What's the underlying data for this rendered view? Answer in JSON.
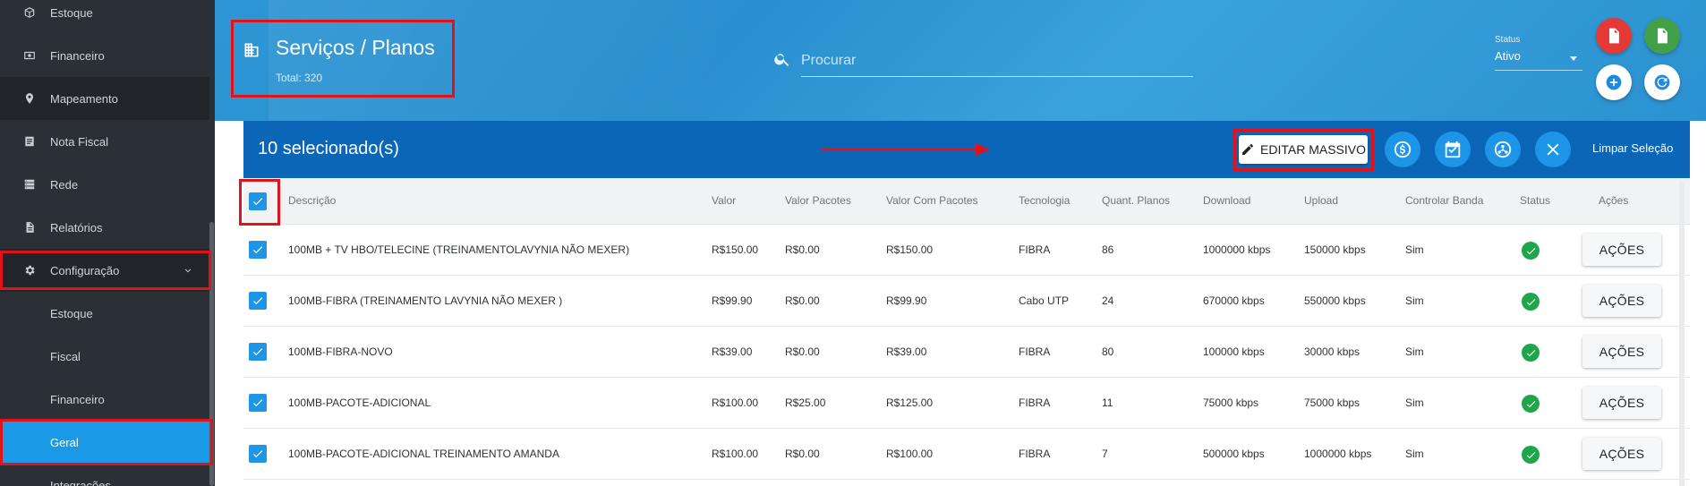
{
  "sidebar": {
    "items": [
      {
        "label": "Estoque",
        "icon": "box-icon"
      },
      {
        "label": "Financeiro",
        "icon": "money-icon"
      },
      {
        "label": "Mapeamento",
        "icon": "map-pin-icon"
      },
      {
        "label": "Nota Fiscal",
        "icon": "receipt-icon"
      },
      {
        "label": "Rede",
        "icon": "server-icon"
      },
      {
        "label": "Relatórios",
        "icon": "report-icon"
      },
      {
        "label": "Configuração",
        "icon": "gear-icon"
      }
    ],
    "subitems": [
      "Estoque",
      "Fiscal",
      "Financeiro",
      "Geral",
      "Integrações"
    ]
  },
  "header": {
    "title": "Serviços / Planos",
    "total": "Total: 320",
    "search_placeholder": "Procurar",
    "status_label": "Status",
    "status_value": "Ativo"
  },
  "selection": {
    "count_text": "10 selecionado(s)",
    "edit_label": "EDITAR MASSIVO",
    "clear_label": "Limpar Seleção"
  },
  "table": {
    "columns": [
      "Descrição",
      "Valor",
      "Valor Pacotes",
      "Valor Com Pacotes",
      "Tecnologia",
      "Quant. Planos",
      "Download",
      "Upload",
      "Controlar Banda",
      "Status",
      "Ações"
    ],
    "action_label": "AÇÕES",
    "rows": [
      {
        "descricao": "100MB + TV HBO/TELECINE (TREINAMENTOLAVYNIA NÃO MEXER)",
        "valor": "R$150.00",
        "valor_pacotes": "R$0.00",
        "valor_com_pacotes": "R$150.00",
        "tecnologia": "FIBRA",
        "quant": "86",
        "download": "1000000 kbps",
        "upload": "150000 kbps",
        "controlar": "Sim"
      },
      {
        "descricao": "100MB-FIBRA (TREINAMENTO LAVYNIA NÃO MEXER )",
        "valor": "R$99.90",
        "valor_pacotes": "R$0.00",
        "valor_com_pacotes": "R$99.90",
        "tecnologia": "Cabo UTP",
        "quant": "24",
        "download": "670000 kbps",
        "upload": "550000 kbps",
        "controlar": "Sim"
      },
      {
        "descricao": "100MB-FIBRA-NOVO",
        "valor": "R$39.00",
        "valor_pacotes": "R$0.00",
        "valor_com_pacotes": "R$39.00",
        "tecnologia": "FIBRA",
        "quant": "80",
        "download": "100000 kbps",
        "upload": "30000 kbps",
        "controlar": "Sim"
      },
      {
        "descricao": "100MB-PACOTE-ADICIONAL",
        "valor": "R$100.00",
        "valor_pacotes": "R$25.00",
        "valor_com_pacotes": "R$125.00",
        "tecnologia": "FIBRA",
        "quant": "11",
        "download": "75000 kbps",
        "upload": "75000 kbps",
        "controlar": "Sim"
      },
      {
        "descricao": "100MB-PACOTE-ADICIONAL TREINAMENTO AMANDA",
        "valor": "R$100.00",
        "valor_pacotes": "R$0.00",
        "valor_com_pacotes": "R$100.00",
        "tecnologia": "FIBRA",
        "quant": "7",
        "download": "500000 kbps",
        "upload": "1000000 kbps",
        "controlar": "Sim"
      }
    ]
  },
  "colors": {
    "header_blue": "#2e96d4",
    "selection_bar": "#0b66b8",
    "active_item": "#1a9ae6",
    "pdf_red": "#e53935",
    "excel_green": "#43a047",
    "status_ok": "#1fa54a",
    "highlight_red": "#e0131b"
  }
}
